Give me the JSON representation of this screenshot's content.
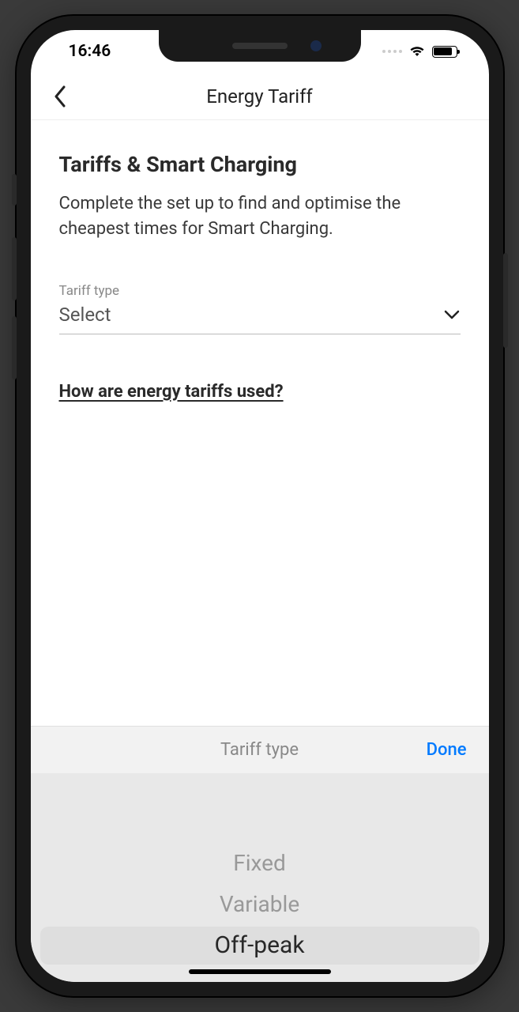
{
  "status": {
    "time": "16:46"
  },
  "nav": {
    "title": "Energy Tariff"
  },
  "heading": "Tariffs & Smart Charging",
  "description": "Complete the set up to find and optimise the cheapest times for Smart Charging.",
  "tariff_field": {
    "label": "Tariff type",
    "value": "Select"
  },
  "help_link": "How are energy tariffs used?",
  "picker": {
    "title": "Tariff type",
    "done": "Done",
    "options": {
      "0": "Fixed",
      "1": "Variable",
      "2": "Off-peak"
    }
  }
}
